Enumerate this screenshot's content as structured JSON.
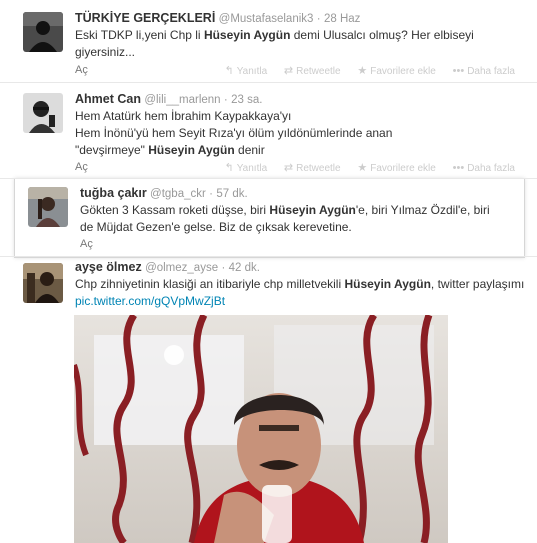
{
  "tweets": [
    {
      "fullname": "TÜRKİYE GERÇEKLERİ",
      "username": "@Mustafaselanik3",
      "time": "28 Haz",
      "text_a": "Eski TDKP li,yeni Chp li ",
      "highlight": "Hüseyin Aygün",
      "text_b": " demi Ulusalcı olmuş? Her elbiseyi giyersiniz...",
      "expand": "Aç"
    },
    {
      "fullname": "Ahmet Can",
      "username": "@lili__marlenn",
      "time": "23 sa.",
      "text_a": "Hem Atatürk hem İbrahim Kaypakkaya'yı\nHem İnönü'yü hem Seyit Rıza'yı ölüm yıldönümlerinde anan\n\"devşirmeye\" ",
      "highlight": "Hüseyin Aygün",
      "text_b": " denir",
      "expand": "Aç"
    },
    {
      "fullname": "tuğba çakır",
      "username": "@tgba_ckr",
      "time": "57 dk.",
      "text_a": "Gökten 3 Kassam roketi düşse, biri ",
      "highlight": "Hüseyin Aygün",
      "text_b": "'e, biri Yılmaz Özdil'e, biri de Müjdat Gezen'e gelse. Biz de çıksak kerevetine.",
      "expand": "Aç"
    },
    {
      "fullname": "ayşe ölmez",
      "username": "@olmez_ayse",
      "time": "42 dk.",
      "text_a": "Chp zihniyetinin klasiği an itibariyle chp milletvekili ",
      "highlight": "Hüseyin Aygün",
      "text_b": ", twitter paylaşımı ",
      "link": "pic.twitter.com/gQVpMwZjBt"
    }
  ],
  "actions": {
    "reply": "Yanıtla",
    "retweet": "Retweetle",
    "favorite": "Favorilere ekle",
    "more": "Daha fazla"
  },
  "colors": {
    "link": "#0084b4",
    "muted": "#999999",
    "action": "#cccccc"
  }
}
